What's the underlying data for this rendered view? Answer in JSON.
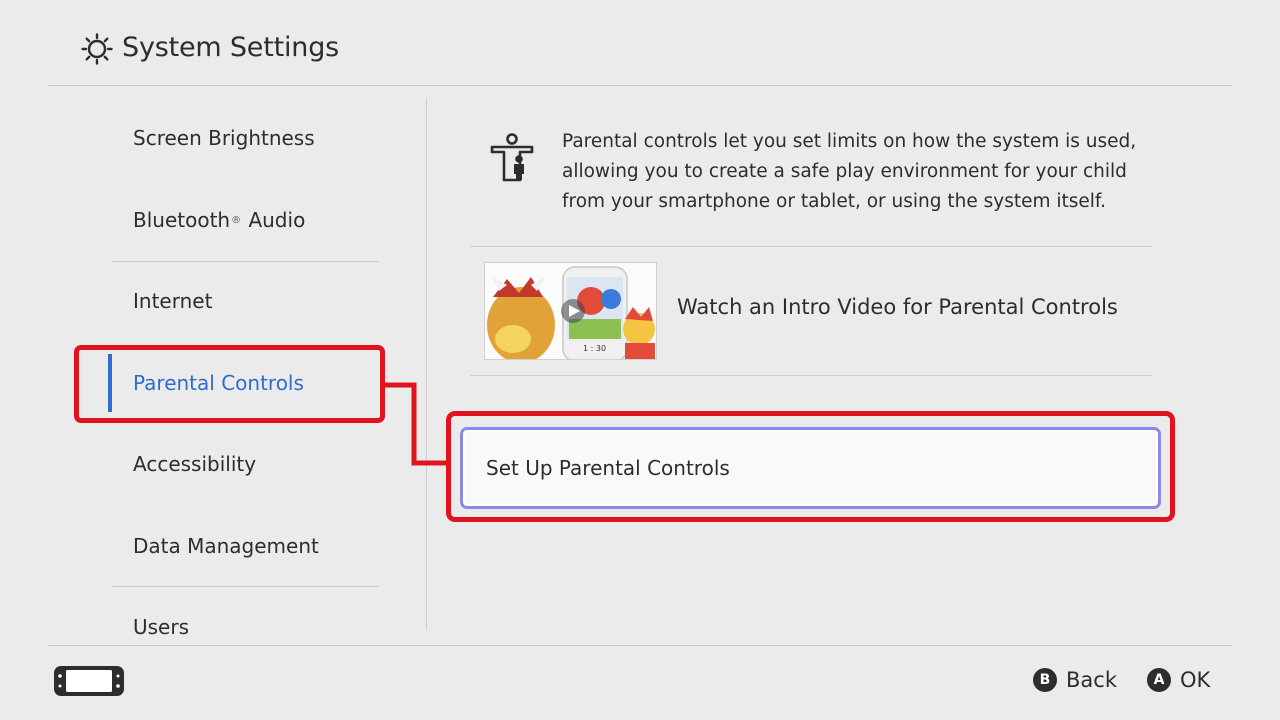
{
  "header": {
    "title": "System Settings",
    "icon": "gear-icon"
  },
  "sidebar": {
    "items": [
      {
        "label": "Screen Brightness"
      },
      {
        "label": "Bluetooth",
        "suffix": "Audio",
        "mark": "®"
      },
      {
        "label": "Internet"
      },
      {
        "label": "Parental Controls",
        "active": true
      },
      {
        "label": "Accessibility"
      },
      {
        "label": "Data Management"
      },
      {
        "label": "Users"
      }
    ]
  },
  "content": {
    "info_icon": "parent-child-icon",
    "info_text": "Parental controls let you set limits on how the system is used, allowing you to create a safe play environment for your child from your smartphone or tablet, or using the system itself.",
    "video": {
      "label": "Watch an Intro Video for Parental Controls",
      "thumb_text": "1 : 30"
    },
    "setup_button": "Set Up Parental Controls"
  },
  "footer": {
    "console_icon": "console-icon",
    "back": {
      "key": "B",
      "label": "Back"
    },
    "ok": {
      "key": "A",
      "label": "OK"
    }
  },
  "colors": {
    "background": "#ebebeb",
    "accent": "#2f6bd1",
    "annotation": "#e0141e",
    "text": "#2d2d2d"
  }
}
